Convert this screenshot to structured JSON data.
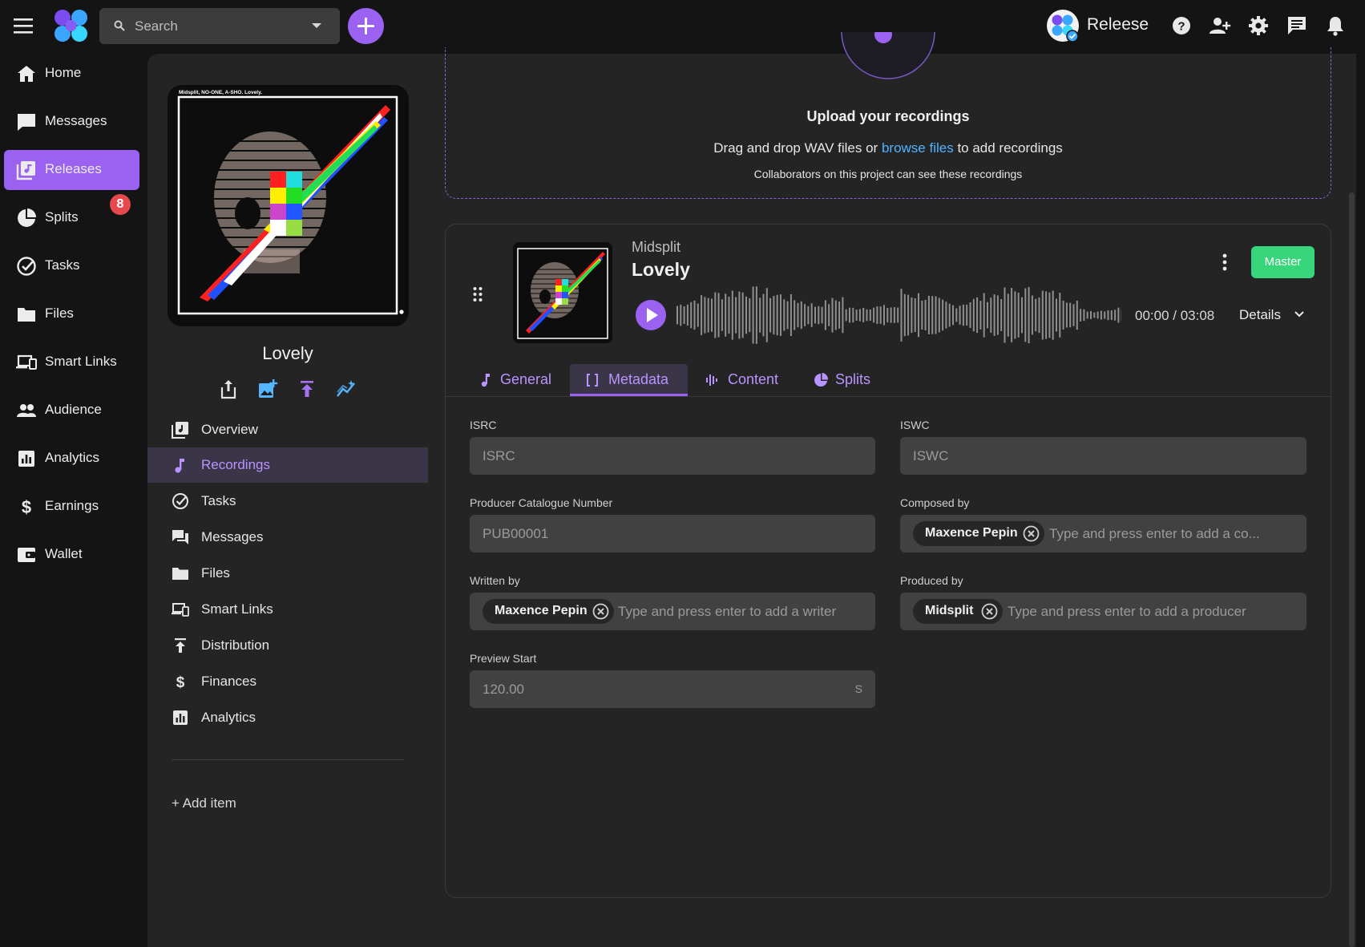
{
  "topbar": {
    "search_placeholder": "Search",
    "username": "Releese"
  },
  "nav": {
    "items": [
      {
        "label": "Home"
      },
      {
        "label": "Messages"
      },
      {
        "label": "Releases"
      },
      {
        "label": "Splits"
      },
      {
        "label": "Tasks"
      },
      {
        "label": "Files"
      },
      {
        "label": "Smart Links"
      },
      {
        "label": "Audience"
      },
      {
        "label": "Analytics"
      },
      {
        "label": "Earnings"
      },
      {
        "label": "Wallet"
      }
    ],
    "splits_badge": "8"
  },
  "release": {
    "cover_caption": "Midsplit, NO-ONE, A-SHO. Lovely.",
    "title": "Lovely",
    "menu": [
      {
        "label": "Overview"
      },
      {
        "label": "Recordings"
      },
      {
        "label": "Tasks"
      },
      {
        "label": "Messages"
      },
      {
        "label": "Files"
      },
      {
        "label": "Smart Links"
      },
      {
        "label": "Distribution"
      },
      {
        "label": "Finances"
      },
      {
        "label": "Analytics"
      }
    ],
    "add_item": "+ Add item"
  },
  "upload": {
    "title": "Upload your recordings",
    "text_before": "Drag and drop WAV files or ",
    "link": "browse files",
    "text_after": " to add recordings",
    "note": "Collaborators on this project can see these recordings"
  },
  "recording": {
    "artist": "Midsplit",
    "title": "Lovely",
    "badge": "Master",
    "time": "00:00 / 03:08",
    "details": "Details",
    "tabs": [
      {
        "label": "General"
      },
      {
        "label": "Metadata"
      },
      {
        "label": "Content"
      },
      {
        "label": "Splits"
      }
    ],
    "metadata": {
      "isrc_label": "ISRC",
      "isrc_placeholder": "ISRC",
      "iswc_label": "ISWC",
      "iswc_placeholder": "ISWC",
      "catalogue_label": "Producer Catalogue Number",
      "catalogue_placeholder": "PUB00001",
      "composed_label": "Composed by",
      "composed_chip": "Maxence Pepin",
      "composed_placeholder": "Type and press enter to add a co...",
      "written_label": "Written by",
      "written_chip": "Maxence Pepin",
      "written_placeholder": "Type and press enter to add a writer",
      "produced_label": "Produced by",
      "produced_chip": "Midsplit",
      "produced_placeholder": "Type and press enter to add a producer",
      "preview_label": "Preview Start",
      "preview_placeholder": "120.00",
      "preview_suffix": "S"
    }
  },
  "colors": {
    "accent": "#9b61f0",
    "master": "#37d67a",
    "link": "#4fb3ff",
    "badge": "#e5484d"
  }
}
